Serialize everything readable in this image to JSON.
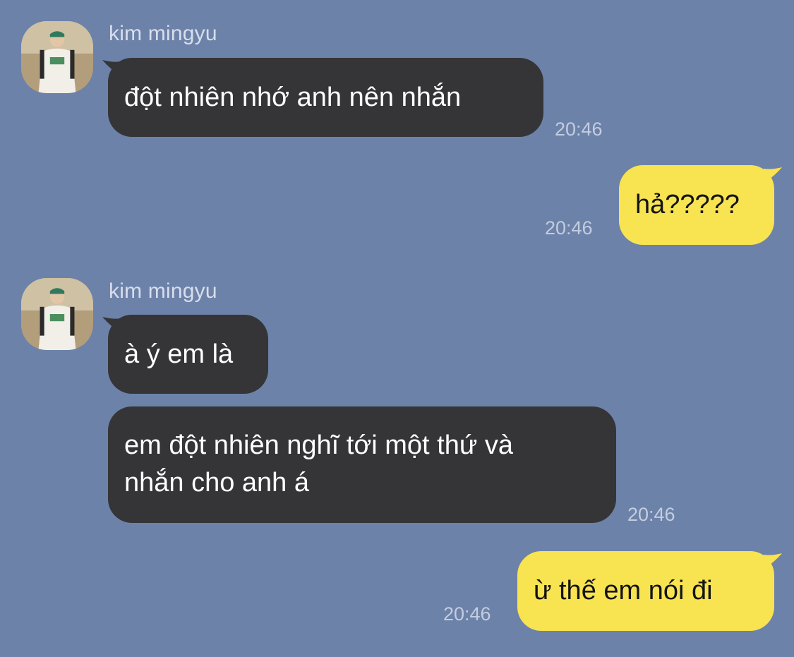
{
  "chat": {
    "messages": [
      {
        "sender": "kim mingyu",
        "text": "đột nhiên nhớ anh nên nhắn",
        "time": "20:46"
      },
      {
        "text": "hả?????",
        "time": "20:46"
      },
      {
        "sender": "kim mingyu",
        "text": "à ý em là"
      },
      {
        "text_lines": [
          "em đột nhiên nghĩ tới một thứ và",
          "nhắn cho anh á"
        ],
        "time": "20:46"
      },
      {
        "text": "ừ thế em nói đi",
        "time": "20:46"
      }
    ]
  },
  "icons": {
    "avatar": "avatar-image"
  },
  "colors": {
    "background": "#6d82a9",
    "incoming_bubble": "#353538",
    "outgoing_bubble": "#f8e351",
    "timestamp": "#c3cde0"
  }
}
